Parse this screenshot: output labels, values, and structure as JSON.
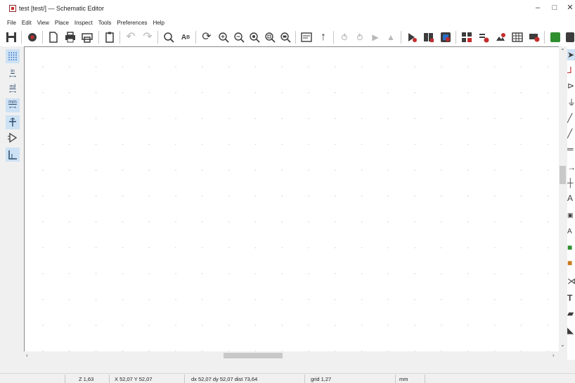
{
  "window": {
    "title": "test [test/] — Schematic Editor",
    "minimize": "–",
    "maximize": "□",
    "close": "✕"
  },
  "menu": [
    "File",
    "Edit",
    "View",
    "Place",
    "Inspect",
    "Tools",
    "Preferences",
    "Help"
  ],
  "toolbar": [
    "save-icon",
    "schematic-setup-icon",
    "page-settings-icon",
    "print-icon",
    "plot-icon",
    "paste-icon",
    "undo-icon",
    "redo-icon",
    "find-icon",
    "find-replace-icon",
    "refresh-icon",
    "zoom-in-icon",
    "zoom-out-icon",
    "zoom-fit-icon",
    "zoom-objects-icon",
    "zoom-selection-icon",
    "hierarchy-navigator-icon",
    "leave-sheet-icon",
    "rotate-ccw-icon",
    "rotate-cw-icon",
    "mirror-h-icon",
    "mirror-v-icon",
    "symbol-editor-icon",
    "symbol-browser-icon",
    "footprint-assign-icon",
    "annotate-icon",
    "erc-icon",
    "bom-icon",
    "fields-table-icon",
    "netlist-icon",
    "pcb-editor-icon"
  ],
  "left_toolbar": [
    "grid-icon",
    "units-inch-icon",
    "units-mil-icon",
    "units-mm-icon",
    "cursor-icon",
    "pin-type-icon",
    "hierarchy-icon"
  ],
  "units_labels": {
    "in": "in",
    "mil": "mil",
    "mm": "mm"
  },
  "right_toolbar": [
    "select-icon",
    "highlight-net-icon",
    "add-symbol-icon",
    "add-power-icon",
    "add-wire-icon",
    "add-bus-icon",
    "add-no-connect-icon",
    "add-wire-entry-icon",
    "add-junction-icon",
    "add-label-icon",
    "add-global-label-icon",
    "add-text-icon",
    "add-image-icon",
    "add-hier-sheet-icon",
    "delete-icon",
    "line-icon",
    "text-icon",
    "image-icon",
    "cursor-icon"
  ],
  "status": {
    "zoom": "Z 1,63",
    "xy": "X 52,07  Y 52,07",
    "delta": "dx 52,07  dy 52,07  dist 73,64",
    "grid": "grid 1,27",
    "units": "mm"
  },
  "colors": {
    "canvas": "#ffffff",
    "grid_dot": "#c8c8c8",
    "chrome": "#f0f0f0",
    "accent": "#2b6cc4"
  }
}
